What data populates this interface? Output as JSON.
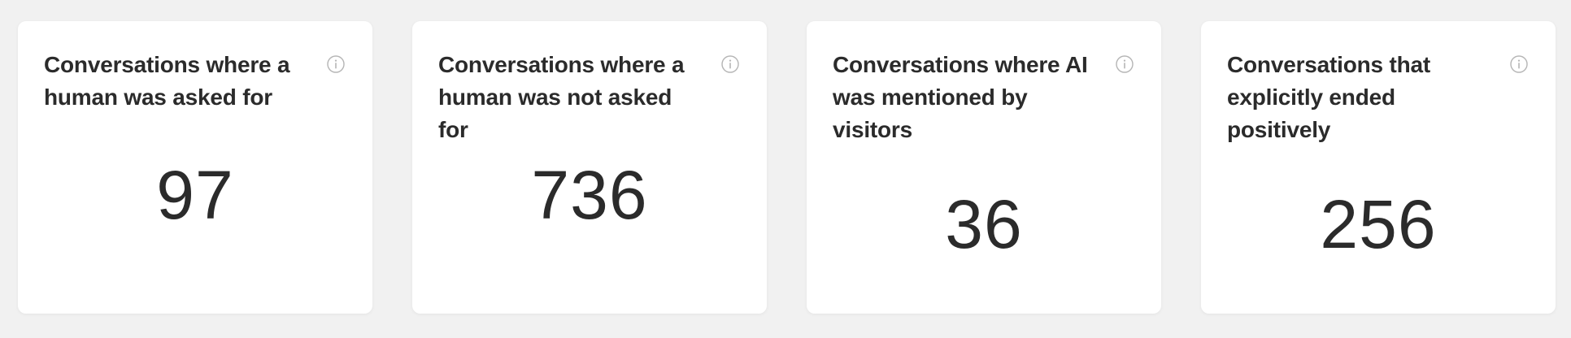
{
  "cards": [
    {
      "title": "Conversations where a human was asked for",
      "value": "97",
      "icon": "info-icon"
    },
    {
      "title": "Conversations where a human was not asked for",
      "value": "736",
      "icon": "info-icon"
    },
    {
      "title": "Conversations where AI was mentioned by visitors",
      "value": "36",
      "icon": "info-icon"
    },
    {
      "title": "Conversations that explicitly ended positively",
      "value": "256",
      "icon": "info-icon"
    }
  ],
  "colors": {
    "background": "#f1f1f1",
    "card": "#ffffff",
    "text": "#2b2b2b",
    "icon": "#b5b5b5"
  }
}
